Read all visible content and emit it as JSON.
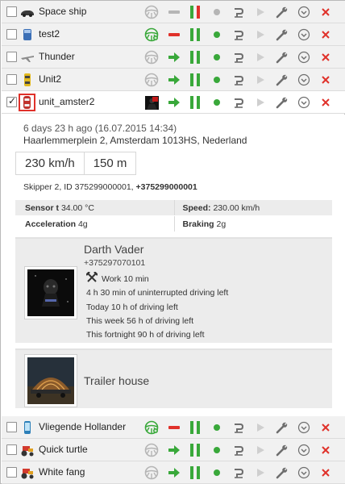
{
  "colors": {
    "green": "#39a83a",
    "red": "#e0312a",
    "grey": "#b5b5b5",
    "dark_icon": "#6e6e6e"
  },
  "units_top": [
    {
      "name": "Space ship",
      "checked": false,
      "icon": "car-icon",
      "driver_icon": "steering-wheel-icon",
      "driver_assigned": false,
      "state_icon": "stop-dash-icon",
      "state": "grey",
      "pause_icon": "pause-icon",
      "pause": "mixed",
      "gps_icon": "gps-dot-icon",
      "gps": "grey"
    },
    {
      "name": "test2",
      "checked": false,
      "icon": "truck-icon",
      "driver_icon": "steering-wheel-icon",
      "driver_assigned": true,
      "state_icon": "stop-dash-icon",
      "state": "red",
      "pause_icon": "pause-icon",
      "pause": "green",
      "gps_icon": "gps-dot-icon",
      "gps": "green"
    },
    {
      "name": "Thunder",
      "checked": false,
      "icon": "plane-icon",
      "driver_icon": "steering-wheel-icon",
      "driver_assigned": false,
      "state_icon": "moving-arrow-icon",
      "state": "green",
      "pause_icon": "pause-icon",
      "pause": "green",
      "gps_icon": "gps-dot-icon",
      "gps": "green"
    },
    {
      "name": "Unit2",
      "checked": false,
      "icon": "taxi-icon",
      "driver_icon": "steering-wheel-icon",
      "driver_assigned": false,
      "state_icon": "moving-arrow-icon",
      "state": "green",
      "pause_icon": "pause-icon",
      "pause": "green",
      "gps_icon": "gps-dot-icon",
      "gps": "green"
    },
    {
      "name": "unit_amster2",
      "checked": true,
      "icon": "car-top-icon",
      "driver_icon": "driver-photo-icon",
      "driver_assigned": true,
      "state_icon": "moving-arrow-icon",
      "state": "green",
      "pause_icon": "pause-icon",
      "pause": "green",
      "gps_icon": "gps-dot-icon",
      "gps": "green"
    }
  ],
  "units_bottom": [
    {
      "name": "Vliegende Hollander",
      "checked": false,
      "icon": "phone-unit-icon",
      "driver_icon": "steering-wheel-icon",
      "driver_assigned": true,
      "state_icon": "stop-dash-icon",
      "state": "red",
      "pause_icon": "pause-icon",
      "pause": "green",
      "gps_icon": "gps-dot-icon",
      "gps": "green"
    },
    {
      "name": "Quick turtle",
      "checked": false,
      "icon": "tractor-icon",
      "driver_icon": "steering-wheel-icon",
      "driver_assigned": false,
      "state_icon": "moving-arrow-icon",
      "state": "green",
      "pause_icon": "pause-icon",
      "pause": "green",
      "gps_icon": "gps-dot-icon",
      "gps": "green"
    },
    {
      "name": "White fang",
      "checked": false,
      "icon": "tractor-icon",
      "driver_icon": "steering-wheel-icon",
      "driver_assigned": false,
      "state_icon": "moving-arrow-icon",
      "state": "green",
      "pause_icon": "pause-icon",
      "pause": "green",
      "gps_icon": "gps-dot-icon",
      "gps": "green"
    }
  ],
  "row_actions": [
    "command-icon",
    "play-track-icon",
    "wrench-icon",
    "dropdown-menu-icon",
    "delete-icon"
  ],
  "details": {
    "last_message": "6 days 23 h ago (16.07.2015 14:34)",
    "address": "Haarlemmerplein 2, Amsterdam 1013HS, Nederland",
    "speed": "230 km/h",
    "altitude": "150 m",
    "driver_prefix": "Skipper 2, ID 375299000001, ",
    "driver_phone": "+375299000001",
    "sensors": [
      [
        {
          "label": "Sensor t",
          "value": "34.00 °C"
        },
        {
          "label": "Speed:",
          "value": "230.00 km/h"
        }
      ],
      [
        {
          "label": "Acceleration",
          "value": "4g"
        },
        {
          "label": "Braking",
          "value": "2g"
        }
      ]
    ],
    "driver_card": {
      "name": "Darth Vader",
      "phone": "+375297070101",
      "work": "Work 10 min",
      "lines": [
        "4 h 30 min of uninterrupted driving left",
        "Today 10 h of driving left",
        "This week 56 h of driving left",
        "This fortnight 90 h of driving left"
      ]
    },
    "trailer_card": {
      "name": "Trailer house"
    }
  }
}
